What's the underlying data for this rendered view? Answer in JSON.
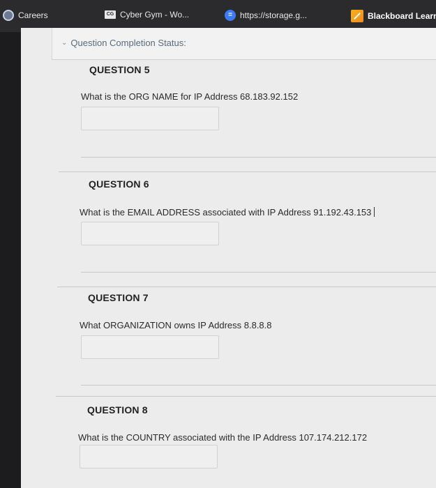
{
  "bookmarks": [
    {
      "label": "Careers",
      "icon": "careers-icon"
    },
    {
      "label": "Cyber Gym - Wo...",
      "icon": "cyber-gym-icon"
    },
    {
      "label": "https://storage.g...",
      "icon": "storage-icon"
    },
    {
      "label": "Blackboard Learn",
      "icon": "blackboard-icon"
    }
  ],
  "status": {
    "label": "Question Completion Status:"
  },
  "questions": [
    {
      "title": "QUESTION 5",
      "text": "What is the ORG NAME for IP Address 68.183.92.152",
      "answer": ""
    },
    {
      "title": "QUESTION 6",
      "text": "What is the EMAIL ADDRESS associated with IP Address  91.192.43.153",
      "answer": ""
    },
    {
      "title": "QUESTION 7",
      "text": "What ORGANIZATION owns IP Address 8.8.8.8",
      "answer": ""
    },
    {
      "title": "QUESTION 8",
      "text": "What is the COUNTRY associated with the IP Address 107.174.212.172",
      "answer": ""
    }
  ]
}
